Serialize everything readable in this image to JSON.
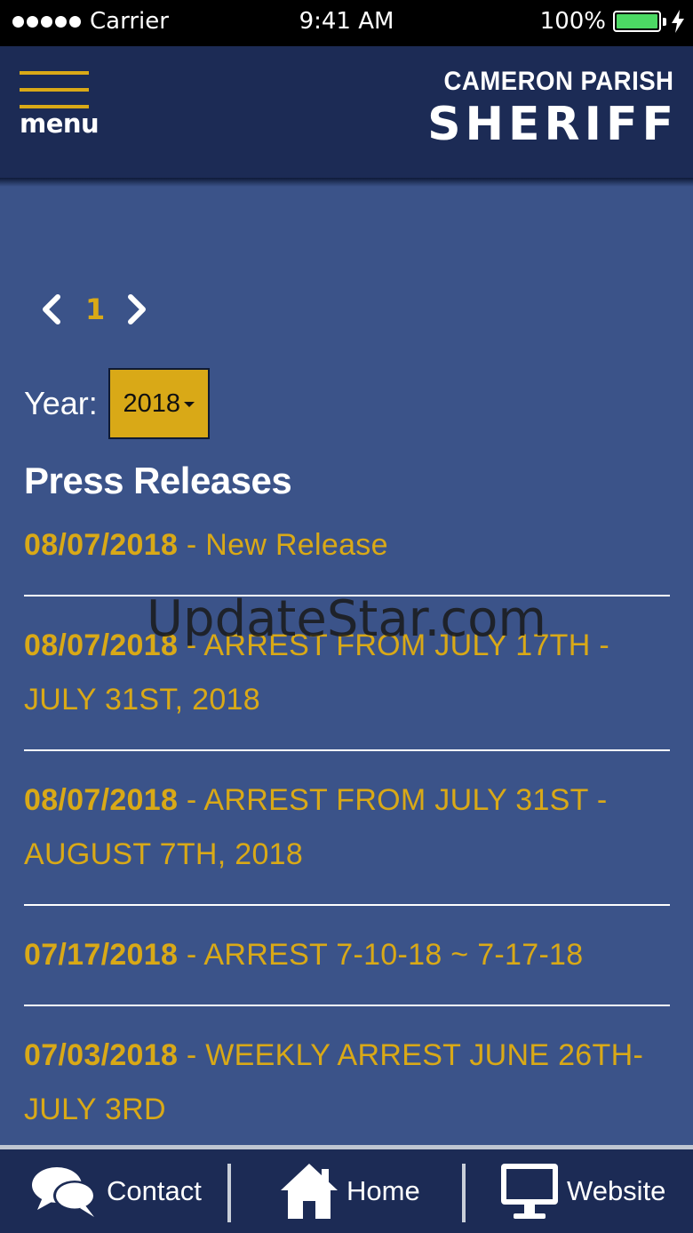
{
  "status_bar": {
    "carrier": "Carrier",
    "time": "9:41 AM",
    "battery": "100%"
  },
  "header": {
    "menu_label": "menu",
    "brand_top": "CAMERON PARISH",
    "brand_main": "SHERIFF"
  },
  "pagination": {
    "current_page": "1"
  },
  "year_filter": {
    "label": "Year:",
    "selected": "2018"
  },
  "section_title": "Press Releases",
  "releases": [
    {
      "date": "08/07/2018",
      "title": " - New Release"
    },
    {
      "date": "08/07/2018",
      "title": " - ARREST FROM JULY 17TH - JULY 31ST, 2018"
    },
    {
      "date": "08/07/2018",
      "title": " - ARREST FROM JULY 31ST - AUGUST 7TH, 2018"
    },
    {
      "date": "07/17/2018",
      "title": " - ARREST 7-10-18 ~ 7-17-18"
    },
    {
      "date": "07/03/2018",
      "title": " - WEEKLY ARREST JUNE 26TH- JULY 3RD"
    }
  ],
  "watermark": "UpdateStar.com",
  "bottom_nav": {
    "contact": "Contact",
    "home": "Home",
    "website": "Website"
  },
  "icons": {
    "menu": "hamburger-icon",
    "prev": "chevron-left-icon",
    "next": "chevron-right-icon",
    "contact": "speech-bubbles-icon",
    "home": "house-icon",
    "website": "monitor-icon"
  },
  "colors": {
    "background": "#3b5389",
    "header": "#1c2b55",
    "accent": "#d9a917"
  }
}
